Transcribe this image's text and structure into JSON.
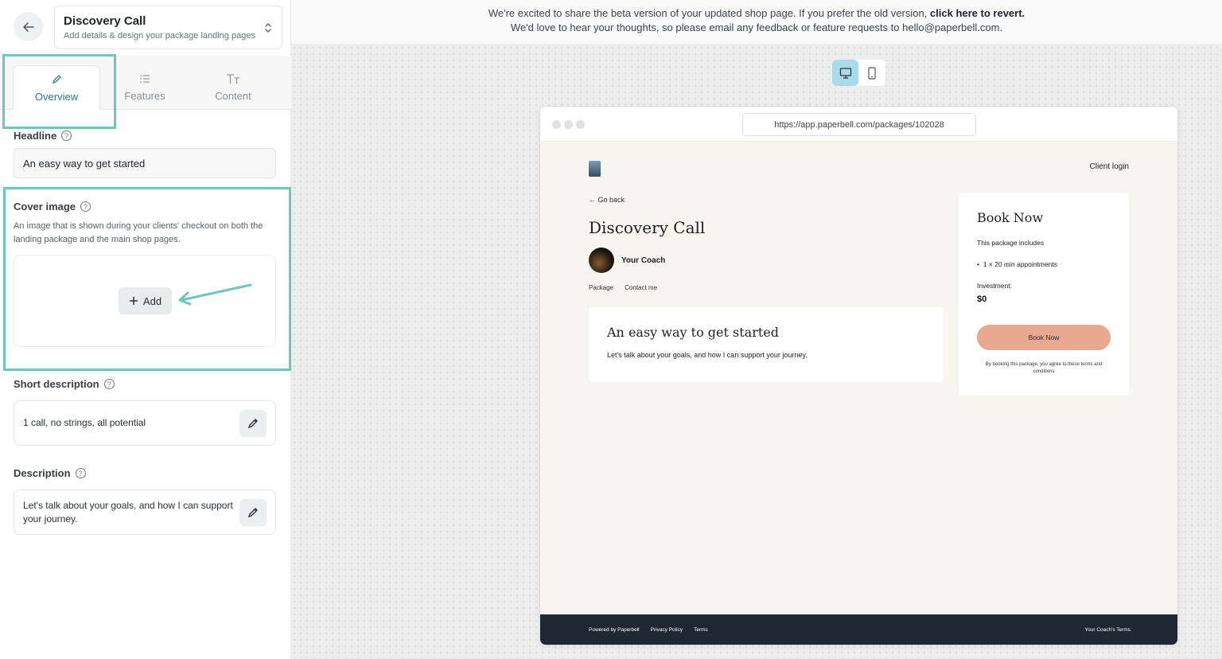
{
  "header": {
    "title": "Discovery Call",
    "subtitle": "Add details & design your package landing pages"
  },
  "tabs": [
    {
      "label": "Overview",
      "icon": "pen-icon",
      "active": true
    },
    {
      "label": "Features",
      "icon": "list-icon",
      "active": false
    },
    {
      "label": "Content",
      "icon": "text-icon",
      "active": false
    }
  ],
  "form": {
    "headline_label": "Headline",
    "headline_value": "An easy way to get started",
    "cover_label": "Cover image",
    "cover_hint": "An image that is shown during your clients' checkout on both the landing package and the main shop pages.",
    "add_label": "Add",
    "short_desc_label": "Short description",
    "short_desc_value": "1 call, no strings, all potential",
    "desc_label": "Description",
    "desc_value": "Let's talk about your goals, and how I can support your journey."
  },
  "banner": {
    "line1_pre": "We're excited to share the beta version of your updated shop page. If you prefer the old version,",
    "line1_link": "click here to revert.",
    "line2": "We'd love to hear your thoughts, so please email any feedback or feature requests to hello@paperbell.com."
  },
  "preview": {
    "url": "https://app.paperbell.com/packages/102028",
    "client_login": "Client login",
    "go_back": "← Go back",
    "title": "Discovery Call",
    "coach": "Your Coach",
    "nav": [
      "Package",
      "Contact me"
    ],
    "card_title": "An easy way to get started",
    "card_text": "Let's talk about your goals, and how I can support your journey.",
    "book_title": "Book Now",
    "includes": "This package includes",
    "item": "1 × 20 min appointments",
    "investment_label": "Investment:",
    "price": "$0",
    "book_button": "Book Now",
    "terms": "By booking this package, you agree to these terms and conditions",
    "footer_links": [
      "Powered by Paperbell",
      "Privacy Policy",
      "Terms"
    ],
    "footer_right": "Your Coach's Terms"
  },
  "colors": {
    "accent": "#2a7a8c",
    "highlight": "#6fc7bb",
    "book_button": "#e8a990",
    "footer": "#1f2732"
  }
}
